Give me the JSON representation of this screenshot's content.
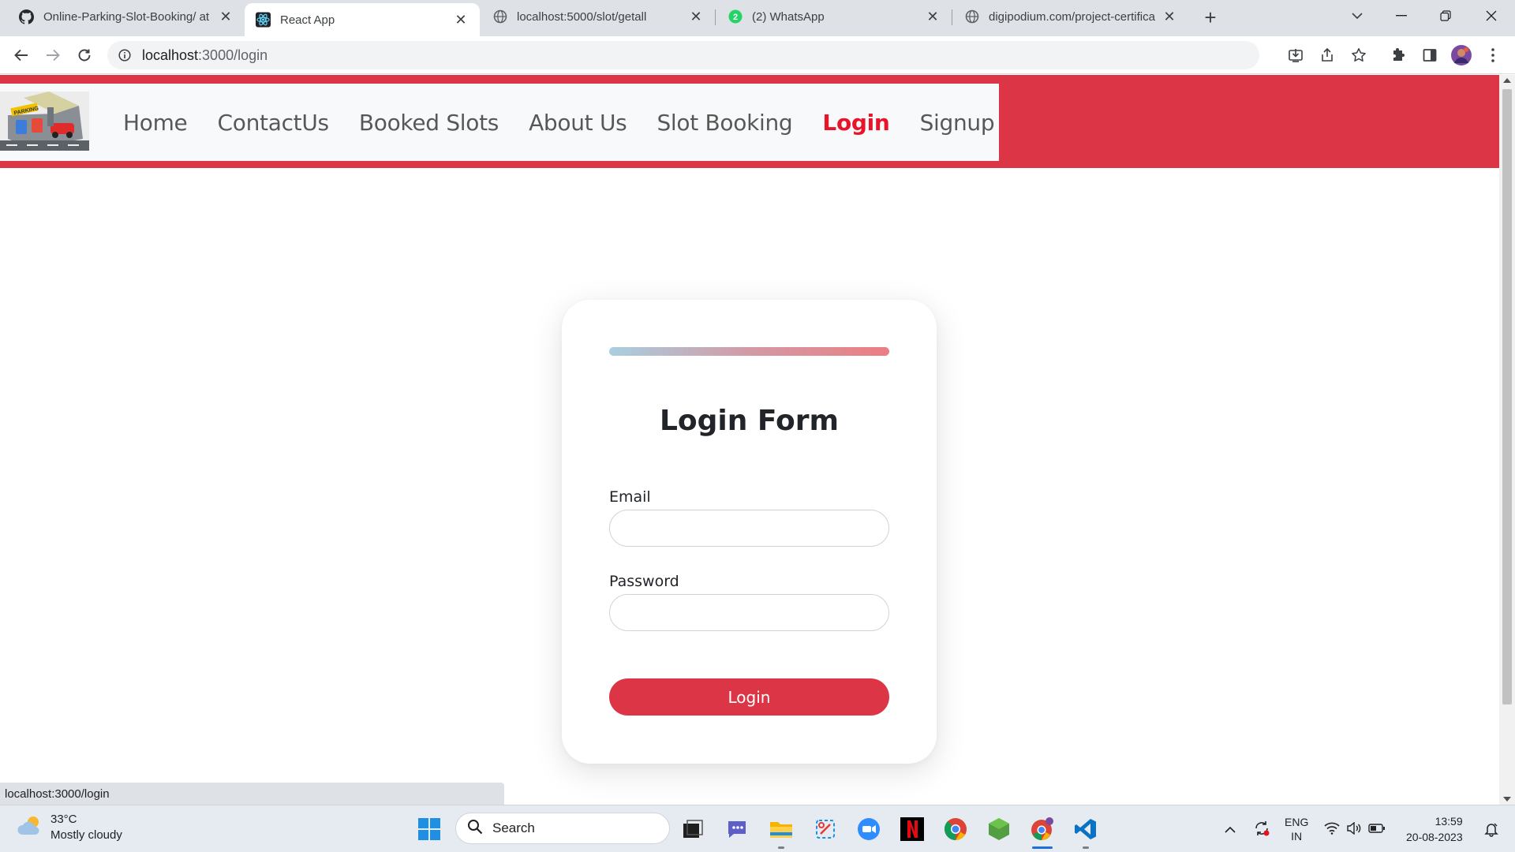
{
  "browser": {
    "tabs": [
      {
        "title": "Online-Parking-Slot-Booking/ at",
        "icon": "github-icon"
      },
      {
        "title": "React App",
        "icon": "react-icon",
        "active": true
      },
      {
        "title": "localhost:5000/slot/getall",
        "icon": "globe-icon"
      },
      {
        "title": "(2) WhatsApp",
        "icon": "whatsapp-icon"
      },
      {
        "title": "digipodium.com/project-certifica",
        "icon": "globe-icon"
      }
    ],
    "whatsapp_badge": "2",
    "url_host": "localhost",
    "url_path": ":3000/login",
    "status_url": "localhost:3000/login"
  },
  "site": {
    "brand_color": "#dc3545",
    "nav": {
      "home": "Home",
      "contact": "ContactUs",
      "booked": "Booked Slots",
      "about": "About Us",
      "slot_booking": "Slot Booking",
      "login": "Login",
      "signup": "Signup"
    },
    "logo_text": "PARKING"
  },
  "login_form": {
    "title": "Login Form",
    "email_label": "Email",
    "email_value": "",
    "password_label": "Password",
    "password_value": "",
    "submit_label": "Login"
  },
  "taskbar": {
    "weather_temp": "33°C",
    "weather_desc": "Mostly cloudy",
    "search_label": "Search",
    "lang_top": "ENG",
    "lang_bottom": "IN",
    "time": "13:59",
    "date": "20-08-2023"
  }
}
